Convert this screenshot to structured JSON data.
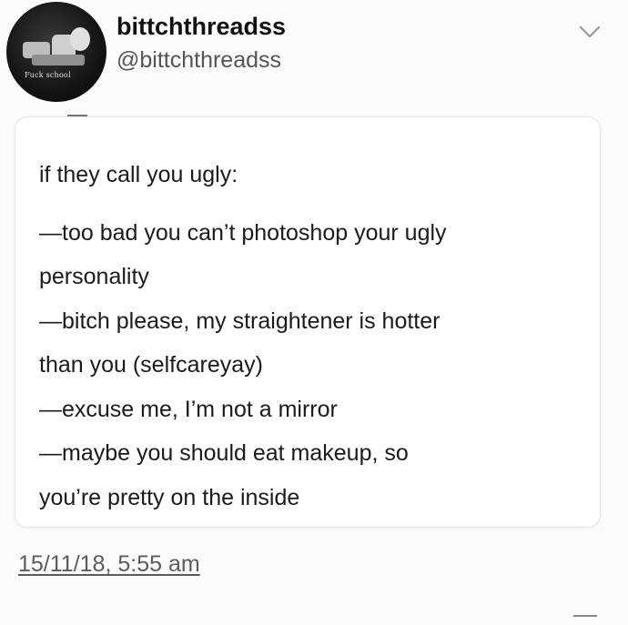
{
  "user": {
    "display_name": "bittchthreadss",
    "handle": "@bittchthreadss",
    "avatar_caption": "Fuck school"
  },
  "post": {
    "lines": [
      "if they call you ugly:",
      "—too bad you can’t photoshop your ugly",
      "personality",
      "—bitch please, my straightener is hotter",
      "than you (selfcareyay)",
      "—excuse me, I’m not a mirror",
      "—maybe you should eat makeup, so",
      "you’re pretty on the inside"
    ],
    "timestamp": "15/11/18, 5:55 am"
  },
  "icons": {
    "menu": "chevron-down-icon"
  }
}
